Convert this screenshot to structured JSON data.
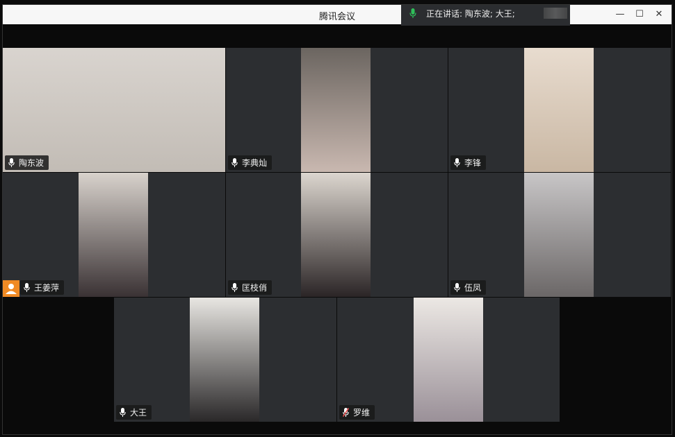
{
  "window": {
    "title": "腾讯会议"
  },
  "speaking": {
    "text": "正在讲话:  陶东波; 大王;"
  },
  "participants": [
    {
      "name": "陶东波",
      "bg": [
        "#d9d4cf",
        "#c2bcb5"
      ]
    },
    {
      "name": "李典灿",
      "bg": [
        "#6b6560",
        "#c9b8b0"
      ]
    },
    {
      "name": "李锋",
      "bg": [
        "#e8dccf",
        "#c9b7a3"
      ]
    },
    {
      "name": "王姜萍",
      "bg": [
        "#d8d2cc",
        "#3a3234"
      ]
    },
    {
      "name": "匡枝俏",
      "bg": [
        "#dcd6cf",
        "#2b2526"
      ]
    },
    {
      "name": "伍凤",
      "bg": [
        "#c8c6c7",
        "#6b6767"
      ]
    },
    {
      "name": "大王",
      "bg": [
        "#e8e6e2",
        "#2a2829"
      ]
    },
    {
      "name": "罗维",
      "bg": [
        "#ece8e4",
        "#9a9098"
      ]
    }
  ]
}
